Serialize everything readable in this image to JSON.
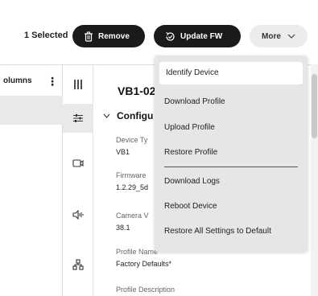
{
  "toolbar": {
    "selected_count": "1 Selected",
    "remove_label": "Remove",
    "update_fw_label": "Update FW",
    "more_label": "More"
  },
  "left_panel": {
    "columns_label": "olumns",
    "kebab": "⋮"
  },
  "detail": {
    "device_title": "VB1-02",
    "section_title": "Configu",
    "fields": [
      {
        "label": "Device Ty",
        "value": "VB1"
      },
      {
        "label": "Firmware",
        "value": "1.2.29_5d"
      },
      {
        "label": "Camera V",
        "value": "38.1"
      },
      {
        "label": "Profile Name",
        "value": "Factory Defaults*"
      },
      {
        "label": "Profile Description",
        "value": ""
      }
    ]
  },
  "menu": {
    "items": [
      "Identify Device",
      "Download Profile",
      "Upload Profile",
      "Restore Profile",
      "Download Logs",
      "Reboot Device",
      "Restore All Settings to Default"
    ]
  },
  "icons": {
    "remove": "trash-icon",
    "update": "refresh-check-icon",
    "more": "chevron-down-icon",
    "rail": [
      "columns-icon",
      "sliders-icon",
      "camera-icon",
      "audio-icon",
      "network-icon"
    ]
  },
  "colors": {
    "dark_button": "#1a1a1a",
    "menu_bg": "#e6e6e6",
    "selected_row": "#e9e9e9"
  }
}
